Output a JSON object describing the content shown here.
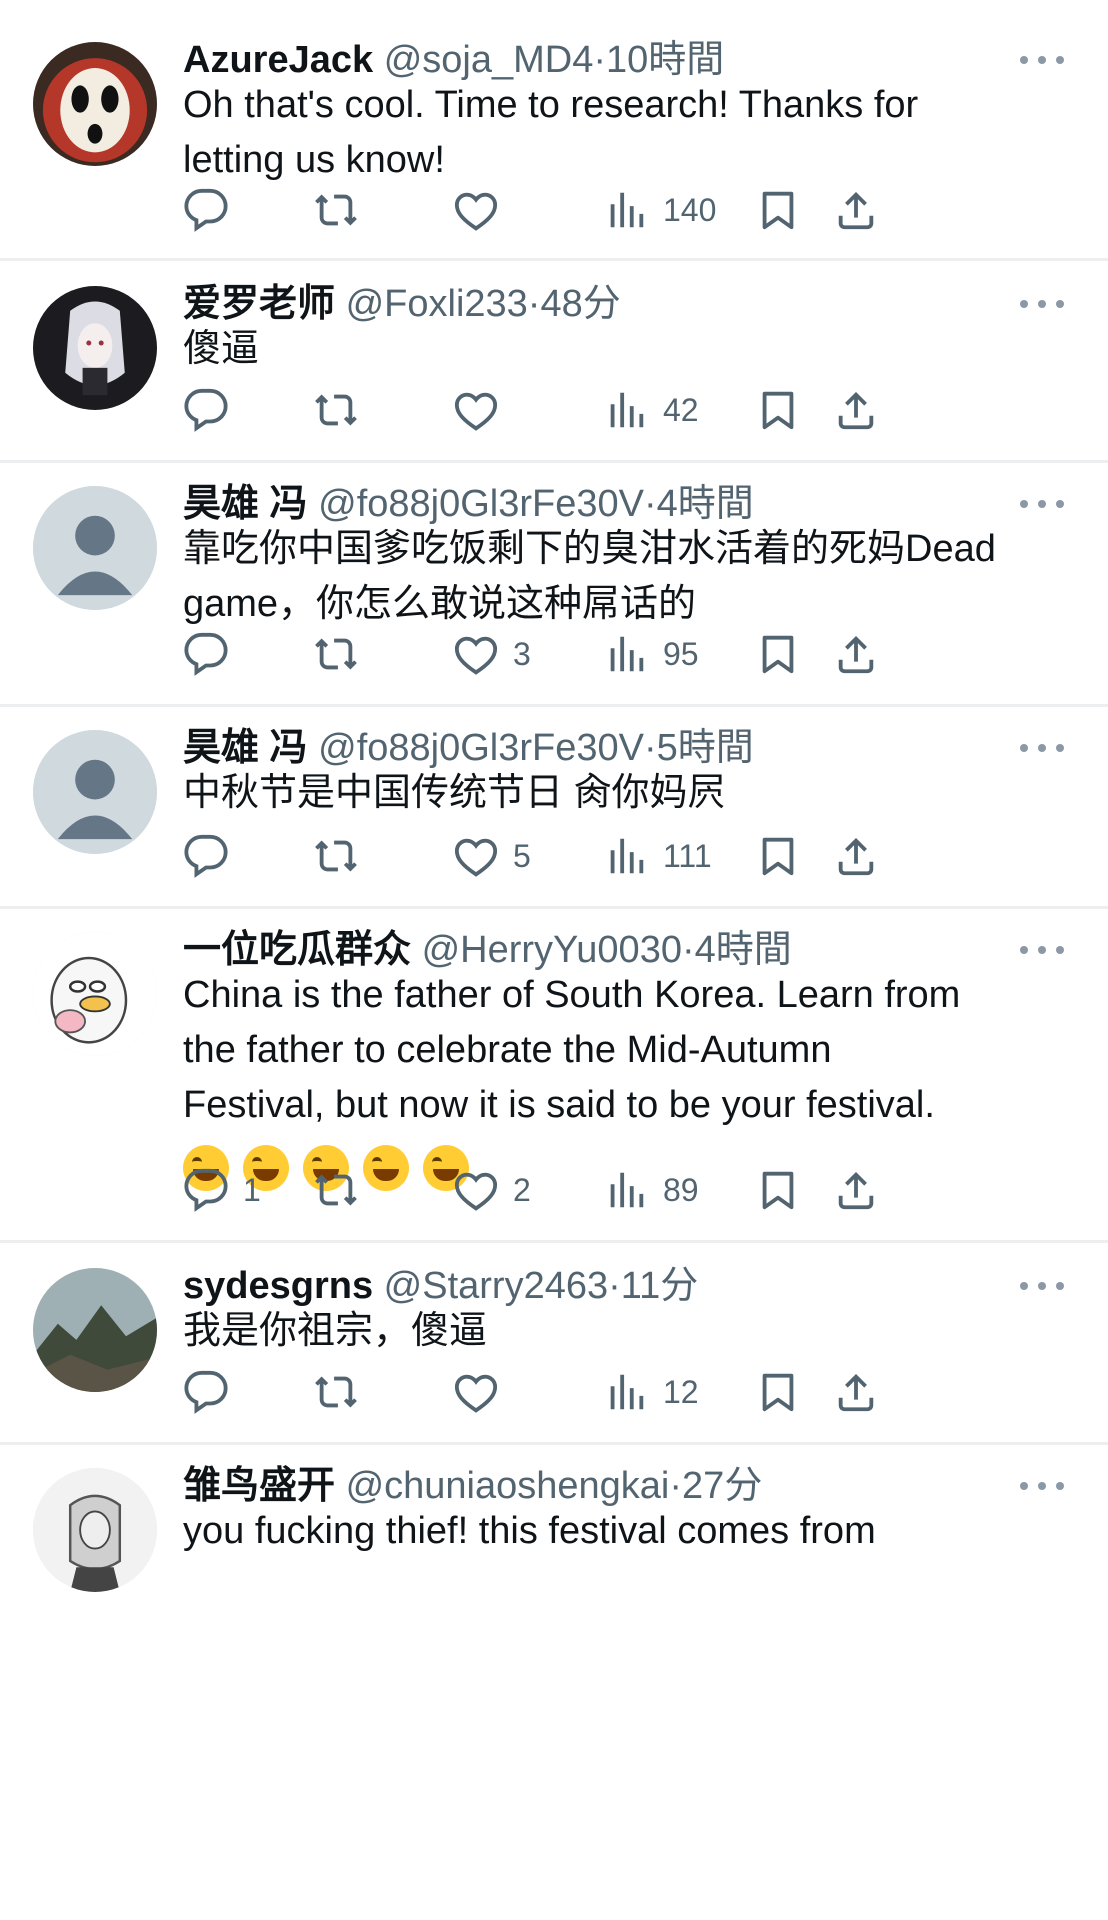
{
  "posts": [
    {
      "name": "AzureJack",
      "handle": "@soja_MD4",
      "time": "10時間",
      "lines": [
        "Oh that's cool. Time to research! Thanks for",
        "letting us know!"
      ],
      "replies": "",
      "likes": "",
      "views": "140"
    },
    {
      "name": "爱罗老师",
      "handle": "@Foxli233",
      "time": "48分",
      "lines": [
        "傻逼"
      ],
      "replies": "",
      "likes": "",
      "views": "42"
    },
    {
      "name": "昊雄 冯",
      "handle": "@fo88j0Gl3rFe30V",
      "time": "4時間",
      "lines": [
        "靠吃你中国爹吃饭剩下的臭泔水活着的死妈Dead",
        "game，你怎么敢说这种屌话的"
      ],
      "replies": "",
      "likes": "3",
      "views": "95"
    },
    {
      "name": "昊雄 冯",
      "handle": "@fo88j0Gl3rFe30V",
      "time": "5時間",
      "lines": [
        "中秋节是中国传统节日  肏你妈屄"
      ],
      "replies": "",
      "likes": "5",
      "views": "111"
    },
    {
      "name": "一位吃瓜群众",
      "handle": "@HerryYu0030",
      "time": "4時間",
      "lines": [
        "China is the father of South Korea. Learn from",
        "the father to celebrate the Mid-Autumn",
        "Festival, but now it is said to be your festival."
      ],
      "emoji_count": 5,
      "replies": "1",
      "likes": "2",
      "views": "89"
    },
    {
      "name": "sydesgrns",
      "handle": "@Starry2463",
      "time": "11分",
      "lines": [
        "我是你祖宗，傻逼"
      ],
      "replies": "",
      "likes": "",
      "views": "12"
    },
    {
      "name": "雏鸟盛开",
      "handle": "@chuniaoshengkai",
      "time": "27分",
      "lines": [
        "you fucking thief! this festival comes from"
      ],
      "replies": "",
      "likes": "",
      "views": ""
    }
  ],
  "dot": "·",
  "colors": {
    "text": "#0f1419",
    "secondary": "#536471",
    "divider": "#eceef0"
  }
}
